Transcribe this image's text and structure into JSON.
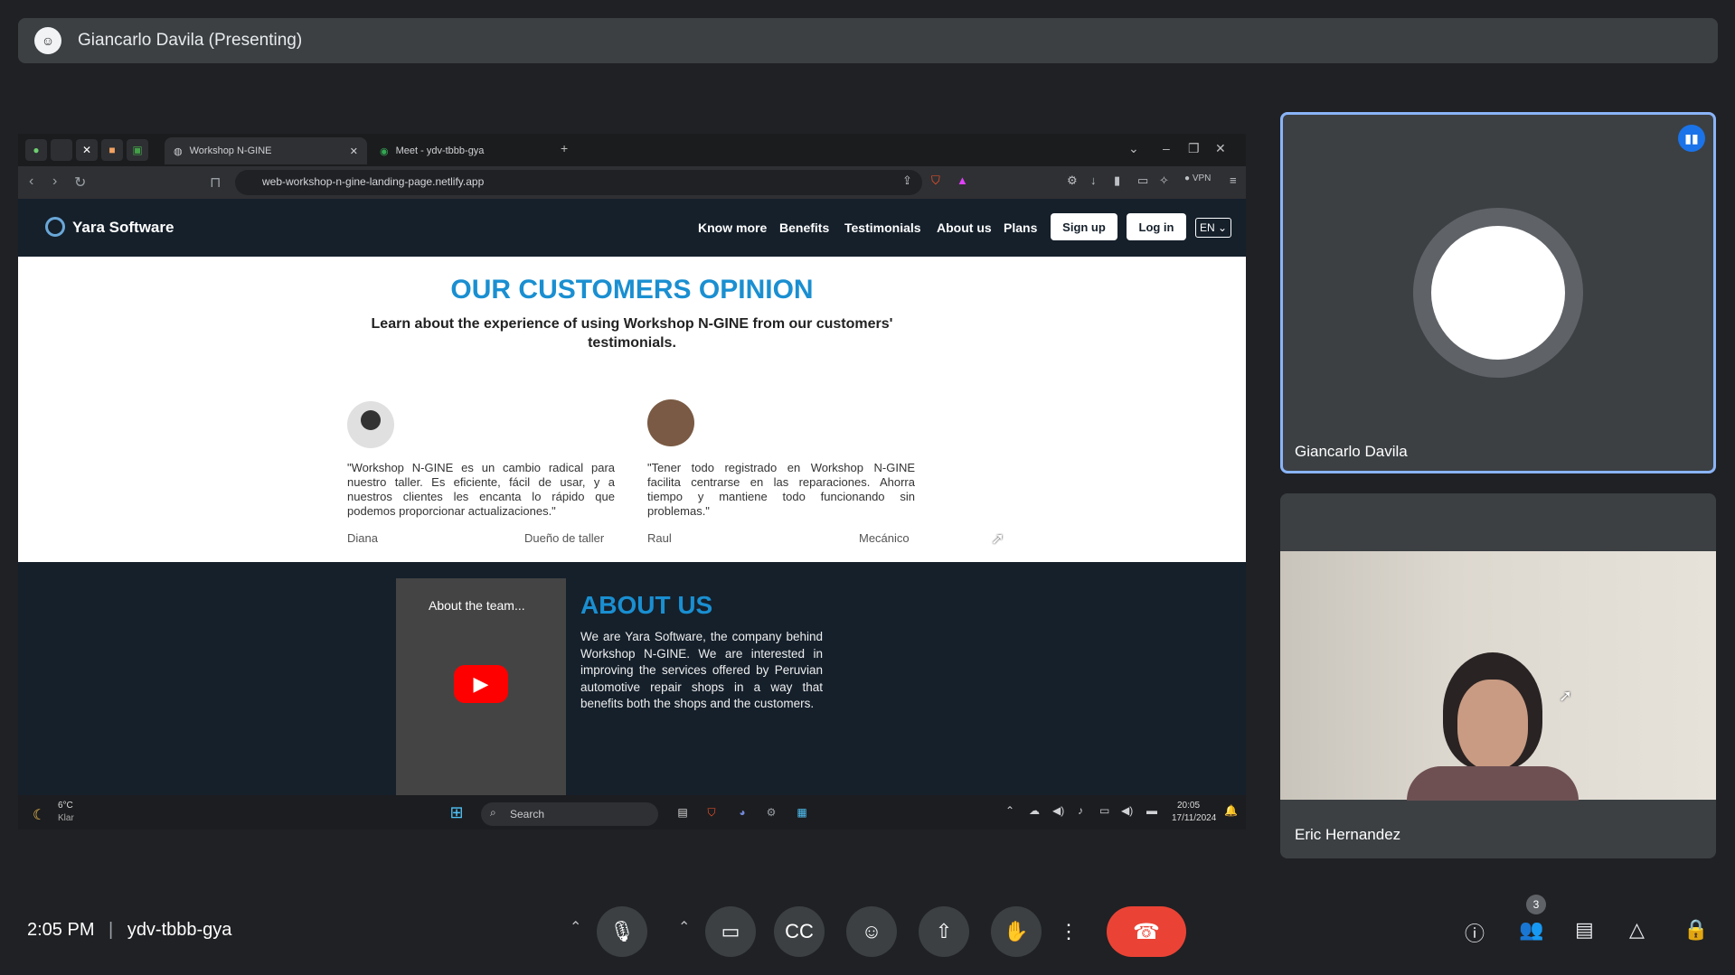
{
  "banner": {
    "presenter": "Giancarlo Davila (Presenting)"
  },
  "browser": {
    "tabs": [
      {
        "label": "Workshop N-GINE",
        "active": true
      },
      {
        "label": "Meet - ydv-tbbb-gya",
        "active": false
      }
    ],
    "url": "web-workshop-n-gine-landing-page.netlify.app",
    "vpn_label": "VPN"
  },
  "site": {
    "brand": "Yara Software",
    "nav": [
      "Know more",
      "Benefits",
      "Testimonials",
      "About us",
      "Plans"
    ],
    "signup": "Sign up",
    "login": "Log in",
    "lang": "EN",
    "title": "OUR CUSTOMERS OPINION",
    "subtitle": "Learn about the experience of using Workshop N-GINE from our customers' testimonials.",
    "testimonials": [
      {
        "quote": "\"Workshop N-GINE es un cambio radical para nuestro taller. Es eficiente, fácil de usar, y a nuestros clientes les encanta lo rápido que podemos proporcionar actualizaciones.\"",
        "name": "Diana",
        "role": "Dueño de taller"
      },
      {
        "quote": "\"Tener todo registrado en Workshop N-GINE facilita centrarse en las reparaciones. Ahorra tiempo y mantiene todo funcionando sin problemas.\"",
        "name": "Raul",
        "role": "Mecánico"
      }
    ],
    "video_title": "About the team...",
    "about_title": "ABOUT US",
    "about_text": "We are Yara Software, the company behind Workshop N-GINE. We are interested in improving the services offered by Peruvian automotive repair shops in a way that benefits both the shops and the customers."
  },
  "taskbar": {
    "weather_temp": "6°C",
    "weather_desc": "Klar",
    "search": "Search",
    "time": "20:05",
    "date": "17/11/2024"
  },
  "participants": [
    {
      "name": "Giancarlo Davila",
      "speaking": true
    },
    {
      "name": "Eric Hernandez",
      "speaking": false
    }
  ],
  "meeting": {
    "time": "2:05 PM",
    "separator": "|",
    "code": "ydv-tbbb-gya",
    "people_count": "3"
  },
  "colors": {
    "accent_blue": "#1a8fd1",
    "hangup_red": "#ea4335",
    "speaking_border": "#8ab4f8"
  }
}
